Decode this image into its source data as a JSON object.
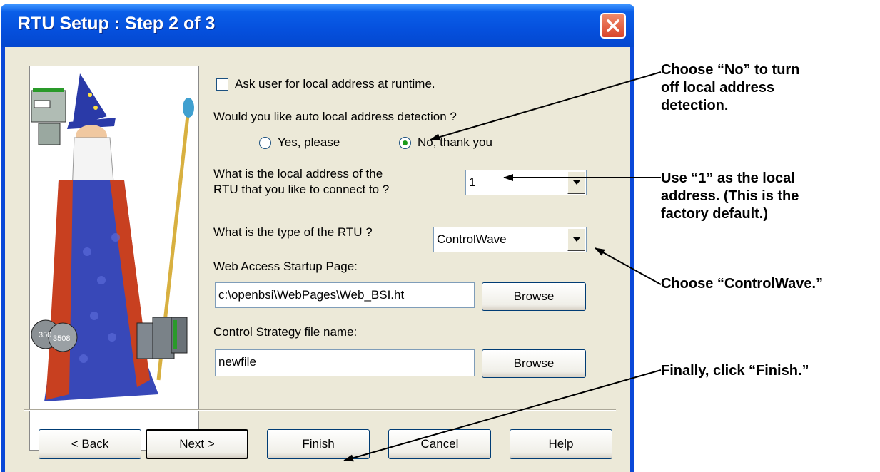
{
  "window": {
    "title": "RTU Setup : Step 2 of 3",
    "close_icon": "close-icon"
  },
  "form": {
    "ask_user_checkbox": {
      "label": "Ask user for local address at runtime.",
      "checked": false
    },
    "auto_detect_question": "Would you like auto local address detection ?",
    "radio_yes": {
      "label": "Yes, please",
      "selected": false
    },
    "radio_no": {
      "label": "No, thank you",
      "selected": true
    },
    "local_address_label_line1": "What is the local address of the",
    "local_address_label_line2": "RTU that you like to connect to ?",
    "local_address_value": "1",
    "rtu_type_label": "What is the type of the RTU ?",
    "rtu_type_value": "ControlWave",
    "web_page_label": "Web Access Startup Page:",
    "web_page_value": "c:\\openbsi\\WebPages\\Web_BSI.ht",
    "browse_label": "Browse",
    "strategy_label": "Control Strategy file name:",
    "strategy_value": "newfile"
  },
  "buttons": {
    "back": "< Back",
    "next": "Next >",
    "finish": "Finish",
    "cancel": "Cancel",
    "help": "Help"
  },
  "wizard_image": {
    "icon": "wizard-illustration",
    "badge_1": "350",
    "badge_2": "3508"
  },
  "annotations": {
    "no_detect": [
      "Choose “No” to turn",
      "off local address",
      "detection."
    ],
    "local_address": [
      "Use “1” as the local",
      "address. (This is the",
      "factory default.)"
    ],
    "controlwave": "Choose “ControlWave.”",
    "finish": "Finally, click “Finish.”"
  },
  "colors": {
    "titlebar": "#0550dd",
    "dialog_face": "#ece9d8",
    "radio_dot": "#1a9a1a"
  }
}
